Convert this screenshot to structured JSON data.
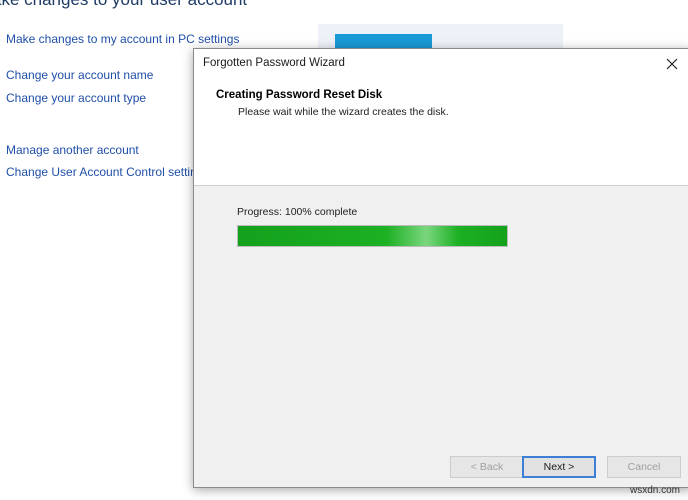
{
  "background": {
    "heading": "ake changes to your user account",
    "links": [
      "Make changes to my account in PC settings",
      "Change your account name",
      "Change your account type",
      "Manage another account",
      "Change User Account Control settings"
    ]
  },
  "dialog": {
    "title": "Forgotten Password Wizard",
    "close_icon": "close-icon",
    "header_title": "Creating Password Reset Disk",
    "header_subtitle": "Please wait while the wizard creates the disk.",
    "progress_label": "Progress: 100% complete",
    "progress_value": 1.0,
    "buttons": {
      "back": "< Back",
      "next": "Next >",
      "cancel": "Cancel"
    },
    "accent_color": "#1cb023"
  },
  "watermark": "wsxdn.com"
}
